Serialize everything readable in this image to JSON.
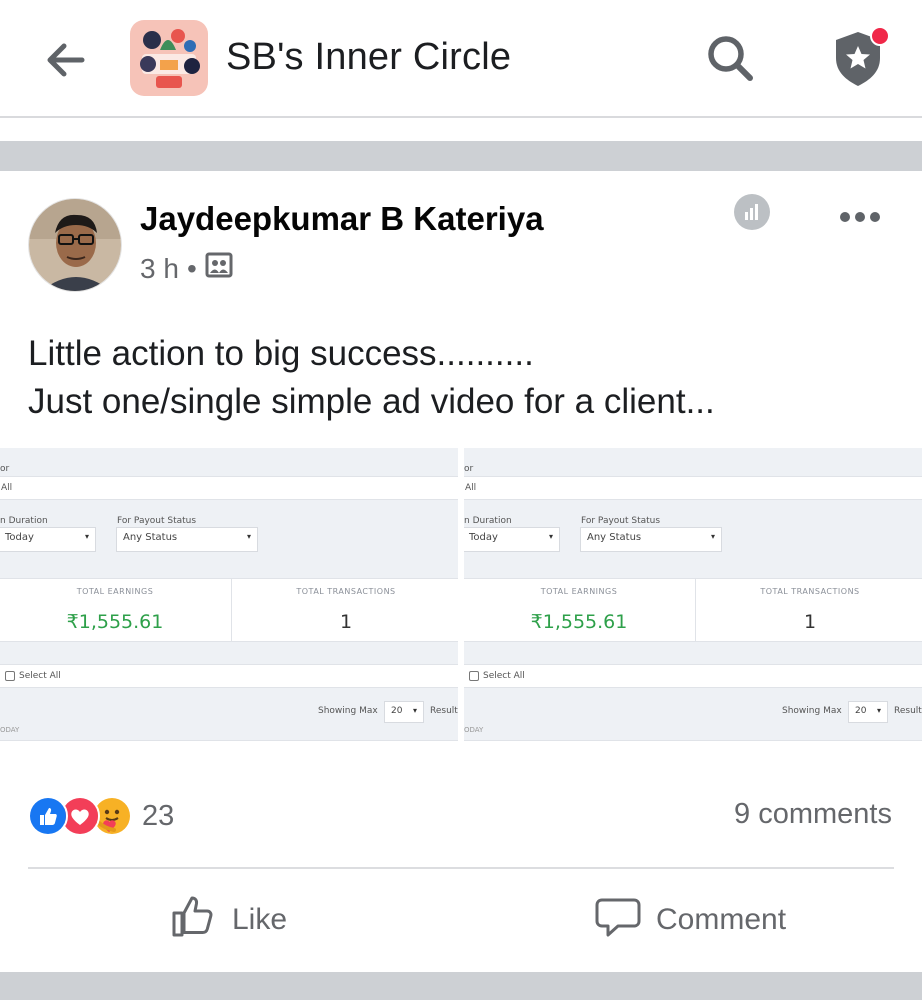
{
  "header": {
    "title": "SB's Inner Circle",
    "icons": {
      "back": "back-arrow-icon",
      "search": "search-icon",
      "shield": "admin-shield-icon"
    },
    "notification_dot_color": "#f02849"
  },
  "post": {
    "author": "Jaydeepkumar B Kateriya",
    "time": "3 h",
    "dot": "•",
    "audience_icon": "group-audience-icon",
    "text_lines": [
      "Little action to big success..........",
      "Just one/single simple ad video for a client..."
    ],
    "screenshots": [
      {
        "label_top": "or",
        "filter_value": "All",
        "duration_label": "n Duration",
        "duration_value": "Today",
        "payout_label": "For Payout Status",
        "payout_value": "Any Status",
        "earnings_label": "TOTAL EARNINGS",
        "earnings_value": "₹1,555.61",
        "transactions_label": "TOTAL TRANSACTIONS",
        "transactions_value": "1",
        "select_all": "Select All",
        "showing_max": "Showing Max",
        "max_value": "20",
        "result": "Result",
        "day_label": "ODAY"
      },
      {
        "label_top": "or",
        "filter_value": "All",
        "duration_label": "n Duration",
        "duration_value": "Today",
        "payout_label": "For Payout Status",
        "payout_value": "Any Status",
        "earnings_label": "TOTAL EARNINGS",
        "earnings_value": "₹1,555.61",
        "transactions_label": "TOTAL TRANSACTIONS",
        "transactions_value": "1",
        "select_all": "Select All",
        "showing_max": "Showing Max",
        "max_value": "20",
        "result": "Result",
        "day_label": "ODAY"
      }
    ],
    "reactions": {
      "icons": [
        "like-reaction-icon",
        "love-reaction-icon",
        "care-reaction-icon"
      ],
      "count": "23"
    },
    "comments": "9 comments",
    "actions": {
      "like": "Like",
      "comment": "Comment"
    }
  },
  "colors": {
    "like_blue": "#1877f2",
    "love_red": "#f33e58",
    "care_yellow": "#f7b125",
    "earnings_green": "#2ea04a",
    "muted_text": "#65676b"
  }
}
